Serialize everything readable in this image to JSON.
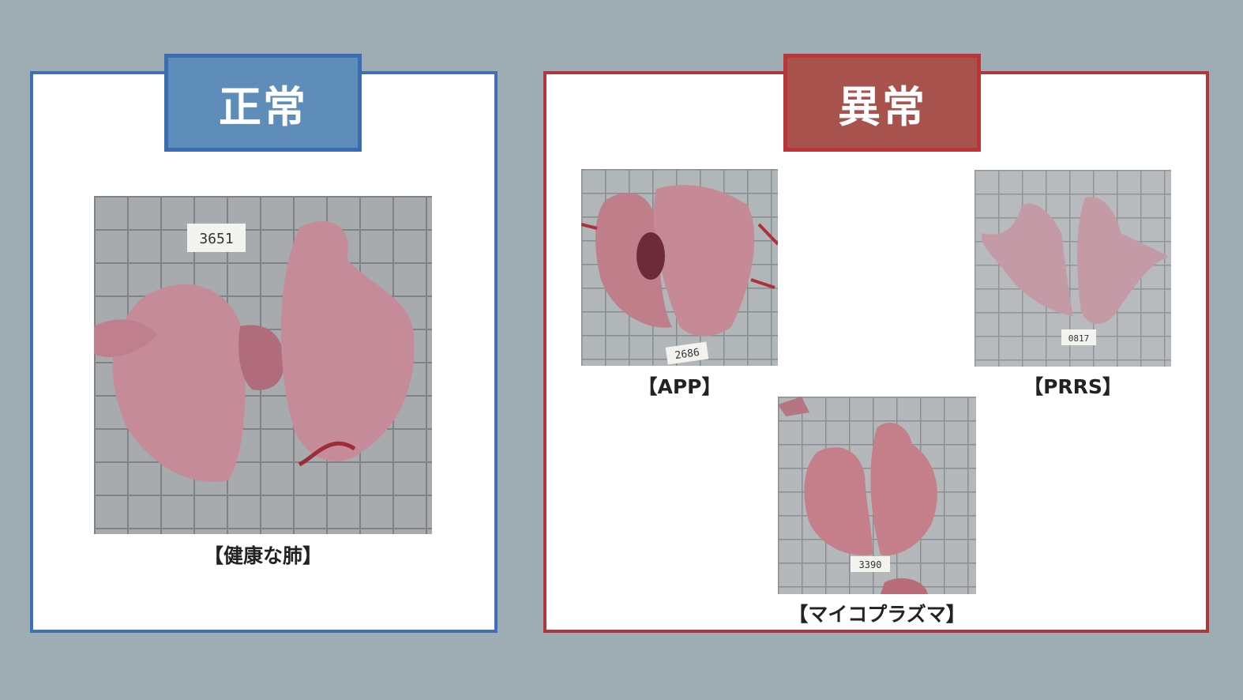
{
  "normal": {
    "heading": "正常",
    "photo": {
      "tag": "3651",
      "caption": "【健康な肺】"
    }
  },
  "abnormal": {
    "heading": "異常",
    "photos": [
      {
        "tag": "2686",
        "caption": "【APP】"
      },
      {
        "tag": "0817",
        "caption": "【PRRS】"
      },
      {
        "tag": "3390",
        "caption": "【マイコプラズマ】"
      }
    ]
  },
  "colors": {
    "background": "#9eacb3",
    "normal_accent": "#3f6fb4",
    "abnormal_accent": "#b3373a"
  }
}
